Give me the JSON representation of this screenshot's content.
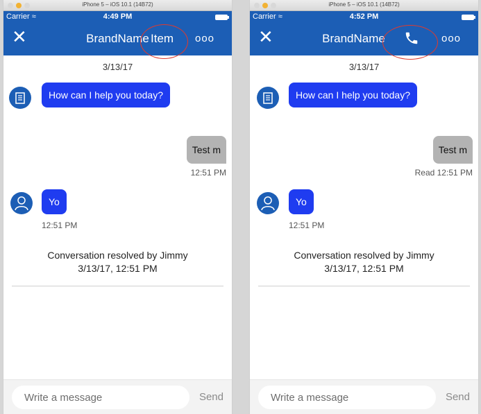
{
  "simulators": [
    {
      "window_title": "iPhone 5 – iOS 10.1 (14B72)",
      "carrier": "Carrier",
      "time": "4:49 PM",
      "close_icon": "close-icon",
      "brand_name": "BrandName",
      "action_label": "Item",
      "more_icon": "more-icon",
      "date": "3/13/17",
      "agent_message": "How can I help you today?",
      "user_message": "Test m",
      "user_message_meta": "12:51 PM",
      "visitor_message": "Yo",
      "visitor_message_meta": "12:51 PM",
      "resolved_line1": "Conversation resolved by Jimmy",
      "resolved_line2": "3/13/17, 12:51 PM",
      "input_placeholder": "Write a message",
      "send_label": "Send"
    },
    {
      "window_title": "iPhone 5 – iOS 10.1 (14B72)",
      "carrier": "Carrier",
      "time": "4:52 PM",
      "close_icon": "close-icon",
      "brand_name": "BrandName",
      "action_icon": "phone-icon",
      "more_icon": "more-icon",
      "date": "3/13/17",
      "agent_message": "How can I help you today?",
      "user_message": "Test m",
      "user_message_meta": "Read  12:51 PM",
      "visitor_message": "Yo",
      "visitor_message_meta": "12:51 PM",
      "resolved_line1": "Conversation resolved by Jimmy",
      "resolved_line2": "3/13/17, 12:51 PM",
      "input_placeholder": "Write a message",
      "send_label": "Send"
    }
  ],
  "colors": {
    "navbar": "#1c5eb5",
    "incoming_bubble": "#1f3cf0",
    "outgoing_bubble": "#b3b3b3",
    "highlight_ring": "#e23a2c"
  }
}
